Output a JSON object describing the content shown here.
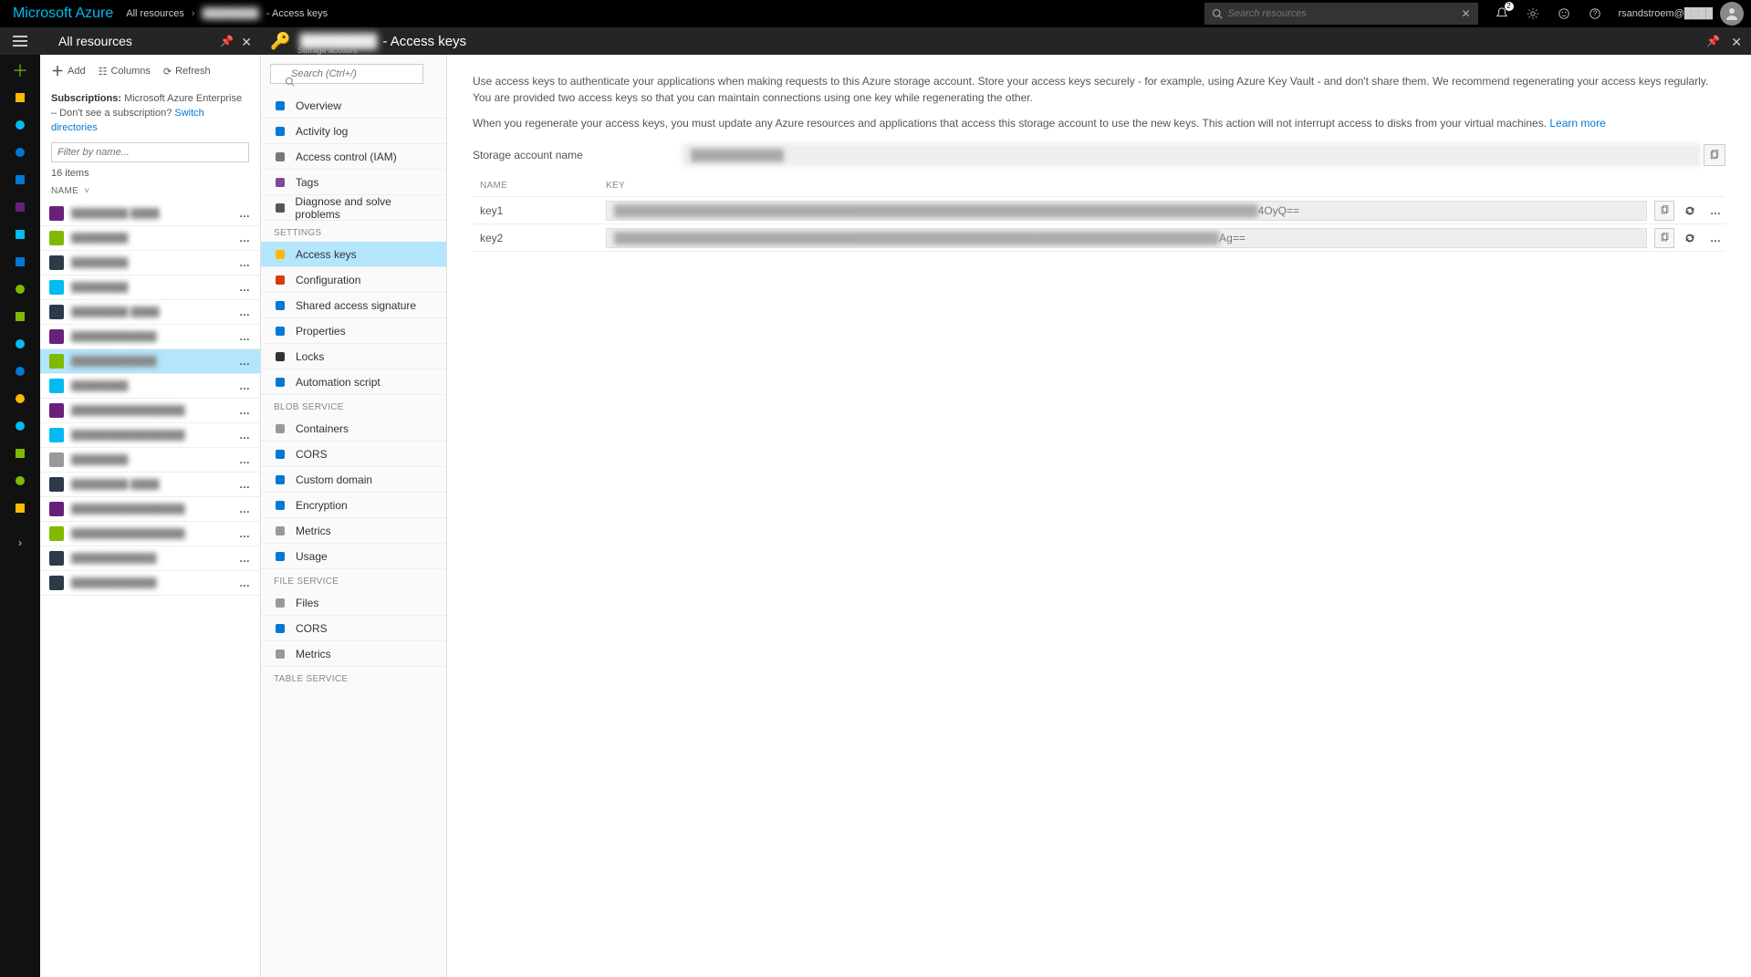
{
  "header": {
    "brand": "Microsoft Azure",
    "crumb1": "All resources",
    "crumb2": "████████",
    "crumb3": "- Access keys",
    "search_placeholder": "Search resources",
    "notif_count": "2",
    "user": "rsandstroem@████"
  },
  "blade": {
    "title": "All resources",
    "subtitle": "████",
    "storage_title_blur": "████████",
    "storage_title_suffix": " - Access keys",
    "storage_type": "Storage account"
  },
  "res_tools": {
    "add": "Add",
    "columns": "Columns",
    "refresh": "Refresh"
  },
  "res_subs": {
    "label": "Subscriptions:",
    "value": " Microsoft Azure Enterprise – Don't see a subscription? ",
    "link": "Switch directories"
  },
  "res_filter_ph": "Filter by name...",
  "res_count": "16 items",
  "res_col_name": "NAME",
  "res_items": [
    {
      "c": "#68217a",
      "t": "████████ ████"
    },
    {
      "c": "#7fba00",
      "t": "████████"
    },
    {
      "c": "#2d3a4a",
      "t": "████████"
    },
    {
      "c": "#00bcf2",
      "t": "████████"
    },
    {
      "c": "#2d3a4a",
      "t": "████████ ████"
    },
    {
      "c": "#68217a",
      "t": "████████████"
    },
    {
      "c": "#7fba00",
      "t": "████████████",
      "sel": true
    },
    {
      "c": "#00bcf2",
      "t": "████████"
    },
    {
      "c": "#68217a",
      "t": "████████████████"
    },
    {
      "c": "#00bcf2",
      "t": "████████████████"
    },
    {
      "c": "#999",
      "t": "████████"
    },
    {
      "c": "#2d3a4a",
      "t": "████████ ████"
    },
    {
      "c": "#68217a",
      "t": "████████████████"
    },
    {
      "c": "#7fba00",
      "t": "████████████████"
    },
    {
      "c": "#2d3a4a",
      "t": "████████████"
    },
    {
      "c": "#2d3a4a",
      "t": "████████████"
    }
  ],
  "nav_search_ph": "Search (Ctrl+/)",
  "nav": {
    "top": [
      {
        "i": "#0078d4",
        "l": "Overview"
      },
      {
        "i": "#0078d4",
        "l": "Activity log"
      },
      {
        "i": "#777",
        "l": "Access control (IAM)"
      },
      {
        "i": "#804998",
        "l": "Tags"
      },
      {
        "i": "#555",
        "l": "Diagnose and solve problems"
      }
    ],
    "sec_settings": "SETTINGS",
    "settings": [
      {
        "i": "#ffb900",
        "l": "Access keys",
        "active": true
      },
      {
        "i": "#d83b01",
        "l": "Configuration"
      },
      {
        "i": "#0078d4",
        "l": "Shared access signature"
      },
      {
        "i": "#0078d4",
        "l": "Properties"
      },
      {
        "i": "#333",
        "l": "Locks"
      },
      {
        "i": "#0078d4",
        "l": "Automation script"
      }
    ],
    "sec_blob": "BLOB SERVICE",
    "blob": [
      {
        "i": "#999",
        "l": "Containers"
      },
      {
        "i": "#0078d4",
        "l": "CORS"
      },
      {
        "i": "#0078d4",
        "l": "Custom domain"
      },
      {
        "i": "#0078d4",
        "l": "Encryption"
      },
      {
        "i": "#999",
        "l": "Metrics"
      },
      {
        "i": "#0078d4",
        "l": "Usage"
      }
    ],
    "sec_file": "FILE SERVICE",
    "file": [
      {
        "i": "#999",
        "l": "Files"
      },
      {
        "i": "#0078d4",
        "l": "CORS"
      },
      {
        "i": "#999",
        "l": "Metrics"
      }
    ],
    "sec_table": "TABLE SERVICE"
  },
  "content": {
    "p1": "Use access keys to authenticate your applications when making requests to this Azure storage account. Store your access keys securely - for example, using Azure Key Vault - and don't share them. We recommend regenerating your access keys regularly. You are provided two access keys so that you can maintain connections using one key while regenerating the other.",
    "p2a": "When you regenerate your access keys, you must update any Azure resources and applications that access this storage account to use the new keys. This action will not interrupt access to disks from your virtual machines. ",
    "p2link": "Learn more",
    "sa_label": "Storage account name",
    "sa_value": "████████████",
    "col_name": "NAME",
    "col_key": "KEY",
    "keys": [
      {
        "name": "key1",
        "blur": "███████████████████████████████████████████████████████████████████████████████████",
        "tail": "4OyQ=="
      },
      {
        "name": "key2",
        "blur": "██████████████████████████████████████████████████████████████████████████████",
        "tail": "Ag=="
      }
    ]
  }
}
